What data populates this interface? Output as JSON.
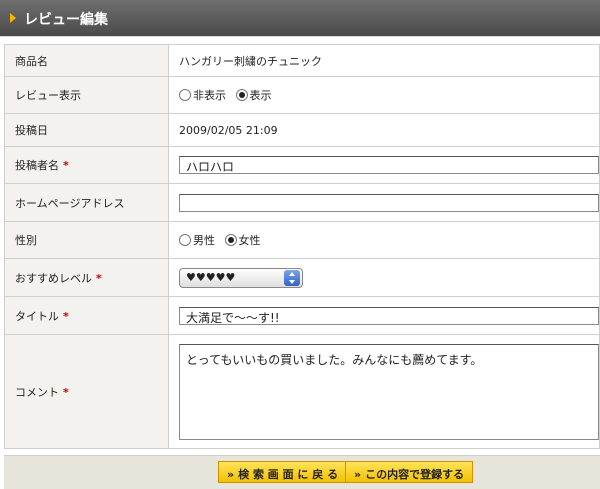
{
  "header": {
    "title": "レビュー編集"
  },
  "form": {
    "product": {
      "label": "商品名",
      "value": "ハンガリー刺繍のチュニック"
    },
    "review_display": {
      "label": "レビュー表示",
      "options": [
        "非表示",
        "表示"
      ],
      "selected": "表示"
    },
    "posted_date": {
      "label": "投稿日",
      "value": "2009/02/05 21:09"
    },
    "poster_name": {
      "label": "投稿者名",
      "required_mark": "*",
      "value": "ハロハロ"
    },
    "homepage": {
      "label": "ホームページアドレス",
      "value": ""
    },
    "gender": {
      "label": "性別",
      "options": [
        "男性",
        "女性"
      ],
      "selected": "女性"
    },
    "recommend": {
      "label": "おすすめレベル",
      "required_mark": "*",
      "value": "♥♥♥♥♥"
    },
    "title": {
      "label": "タイトル",
      "required_mark": "*",
      "value": "大満足で〜〜す!!"
    },
    "comment": {
      "label": "コメント",
      "required_mark": "*",
      "value": "とってもいいもの買いました。みんなにも薦めてます。"
    }
  },
  "buttons": {
    "back": "検 索 画 面 に 戻 る",
    "register": "この内容で登録する",
    "chevron": "»"
  }
}
